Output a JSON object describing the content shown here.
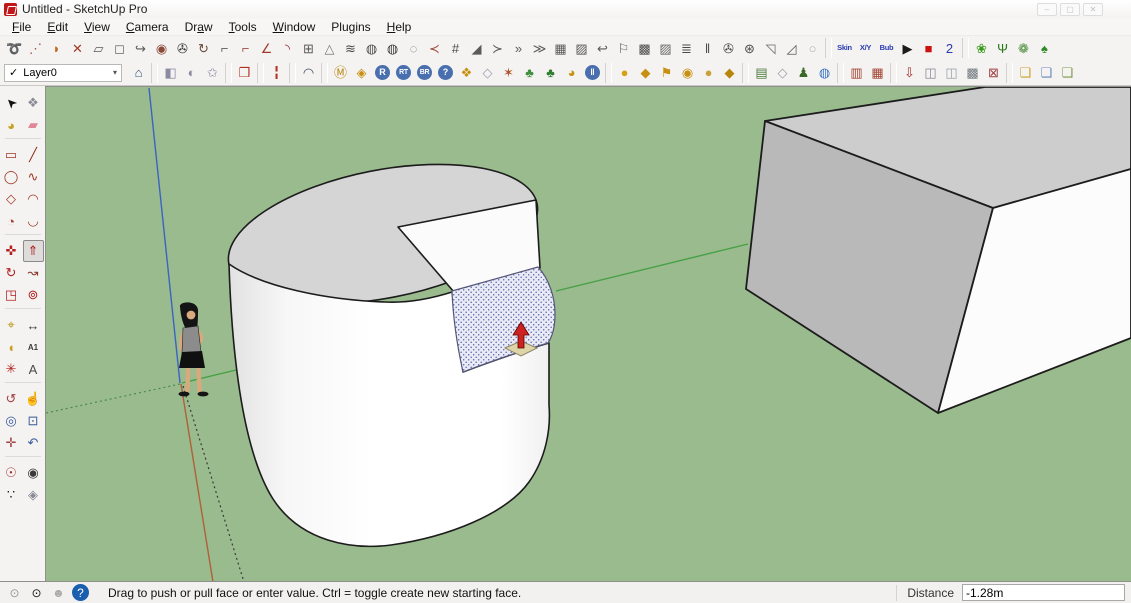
{
  "window": {
    "title": "Untitled - SketchUp Pro",
    "buttons": [
      {
        "name": "minimize-button",
        "glyph": "–"
      },
      {
        "name": "maximize-button",
        "glyph": "▢"
      },
      {
        "name": "close-button",
        "glyph": "✕"
      }
    ]
  },
  "menu": {
    "items": [
      {
        "name": "menu-file",
        "pre": "",
        "u": "F",
        "post": "ile"
      },
      {
        "name": "menu-edit",
        "pre": "",
        "u": "E",
        "post": "dit"
      },
      {
        "name": "menu-view",
        "pre": "",
        "u": "V",
        "post": "iew"
      },
      {
        "name": "menu-camera",
        "pre": "",
        "u": "C",
        "post": "amera"
      },
      {
        "name": "menu-draw",
        "pre": "Dr",
        "u": "a",
        "post": "w"
      },
      {
        "name": "menu-tools",
        "pre": "",
        "u": "T",
        "post": "ools"
      },
      {
        "name": "menu-window",
        "pre": "",
        "u": "W",
        "post": "indow"
      },
      {
        "name": "menu-plugins",
        "pre": "Plugins",
        "u": "",
        "post": ""
      },
      {
        "name": "menu-help",
        "pre": "",
        "u": "H",
        "post": "elp"
      }
    ]
  },
  "toolbar1": {
    "icons": [
      {
        "name": "loop-tool-icon",
        "glyph": "➰",
        "color": "#5a5a5a"
      },
      {
        "name": "dotted-arc-tool-icon",
        "glyph": "⋰",
        "color": "#a05040"
      },
      {
        "name": "orange-sweep-tool-icon",
        "glyph": "◗",
        "color": "#c06a20"
      },
      {
        "name": "red-cut-tool-icon",
        "glyph": "✕",
        "color": "#a03a2a"
      },
      {
        "name": "outline-polygon-tool-icon",
        "glyph": "▱",
        "color": "#5a5a5a"
      },
      {
        "name": "outline-shape-tool-icon",
        "glyph": "◻",
        "color": "#6a6a6a"
      },
      {
        "name": "curl-tool-icon",
        "glyph": "↪",
        "color": "#5a5a5a"
      },
      {
        "name": "red-dot-shape-tool-icon",
        "glyph": "◉",
        "color": "#8a4a3a"
      },
      {
        "name": "knot-tool-icon",
        "glyph": "✇",
        "color": "#3a3a3a"
      },
      {
        "name": "curl-arrow-tool-icon",
        "glyph": "↻",
        "color": "#6a4a3a"
      },
      {
        "name": "corner-lines-tool-icon",
        "glyph": "⌐",
        "color": "#5a5a5a"
      },
      {
        "name": "corner-red-tool-icon",
        "glyph": "⌐",
        "color": "#a04a3a"
      },
      {
        "name": "angle-arrow-tool-icon",
        "glyph": "∠",
        "color": "#a03a2a"
      },
      {
        "name": "red-curve-tool-icon",
        "glyph": "◝",
        "color": "#8a2a2a"
      },
      {
        "name": "grid-box-tool-icon",
        "glyph": "⊞",
        "color": "#5a5a5a"
      },
      {
        "name": "cone-tool-icon",
        "glyph": "△",
        "color": "#7a7a7a"
      },
      {
        "name": "wave-texture-tool-icon",
        "glyph": "≋",
        "color": "#4a4a4a"
      },
      {
        "name": "dark-sphere-tool-icon",
        "glyph": "◍",
        "color": "#4a4a4a"
      },
      {
        "name": "dark-sphere-2-tool-icon",
        "glyph": "◍",
        "color": "#3a3a3a"
      },
      {
        "name": "outline-curl-tool-icon",
        "glyph": "◌",
        "color": "#6a6a6a"
      },
      {
        "name": "red-bracket-tool-icon",
        "glyph": "≺",
        "color": "#a04a3a"
      },
      {
        "name": "fence-tool-icon",
        "glyph": "#",
        "color": "#4a4a4a"
      },
      {
        "name": "wedge-tool-icon",
        "glyph": "◢",
        "color": "#5a5a5a"
      },
      {
        "name": "arrow-tool-icon",
        "glyph": "≻",
        "color": "#5a5a5a"
      },
      {
        "name": "double-arrow-tool-icon",
        "glyph": "»",
        "color": "#5a5a5a"
      },
      {
        "name": "triple-arrow-tool-icon",
        "glyph": "≫",
        "color": "#5a5a5a"
      },
      {
        "name": "textured-square-tool-icon",
        "glyph": "▦",
        "color": "#5a5a5a"
      },
      {
        "name": "stripes-tool-icon",
        "glyph": "▨",
        "color": "#5a5a5a"
      },
      {
        "name": "small-curl-tool-icon",
        "glyph": "↩",
        "color": "#5a5a5a"
      },
      {
        "name": "flag-tool-icon",
        "glyph": "⚐",
        "color": "#5a5a5a"
      },
      {
        "name": "grid-dark-tool-icon",
        "glyph": "▩",
        "color": "#4a4a4a"
      },
      {
        "name": "hatch-square-tool-icon",
        "glyph": "▨",
        "color": "#6a6a6a"
      },
      {
        "name": "stacked-lines-tool-icon",
        "glyph": "≣",
        "color": "#4a4a4a"
      },
      {
        "name": "vertical-bars-tool-icon",
        "glyph": "‖",
        "color": "#4a4a4a"
      },
      {
        "name": "knot-2-tool-icon",
        "glyph": "✇",
        "color": "#4a4a4a"
      },
      {
        "name": "spoke-arrows-tool-icon",
        "glyph": "⊛",
        "color": "#4a4a4a"
      },
      {
        "name": "fan-tool-icon",
        "glyph": "◹",
        "color": "#6a6a6a"
      },
      {
        "name": "striped-fan-tool-icon",
        "glyph": "◿",
        "color": "#5a5a5a"
      },
      {
        "name": "pale-octagon-tool-icon",
        "glyph": "○",
        "color": "#b0b0b0"
      },
      {
        "sep": true
      },
      {
        "name": "skin-tool-icon",
        "glyph": "Skin",
        "color": "#2a3ab0",
        "small": true
      },
      {
        "name": "xy-tool-icon",
        "glyph": "X/Y",
        "color": "#2a3ab0",
        "small": true
      },
      {
        "name": "bubble-tool-icon",
        "glyph": "Bub",
        "color": "#2a3ab0",
        "small": true
      },
      {
        "name": "play-button-icon",
        "glyph": "▶",
        "color": "#1a1a1a"
      },
      {
        "name": "stop-button-icon",
        "glyph": "■",
        "color": "#cc1111"
      },
      {
        "name": "s2-tool-icon",
        "glyph": "2",
        "color": "#2a3ab0"
      },
      {
        "sep": true
      },
      {
        "name": "plant-turnip-icon",
        "glyph": "❀",
        "color": "#3a9a1a"
      },
      {
        "name": "plant-grass-icon",
        "glyph": "Ψ",
        "color": "#2a7a1a"
      },
      {
        "name": "plant-swirl-icon",
        "glyph": "❁",
        "color": "#4a8a3a"
      },
      {
        "name": "plant-bush-icon",
        "glyph": "♠",
        "color": "#2a8a2a"
      }
    ]
  },
  "toolbar2": {
    "check": "✓",
    "layer": "Layer0",
    "arrow": "▾",
    "icons": [
      {
        "name": "house-info-icon",
        "glyph": "⌂",
        "color": "#33557a"
      },
      {
        "sep": true
      },
      {
        "name": "face-camera-1-icon",
        "glyph": "◧",
        "color": "#8a8aa0"
      },
      {
        "name": "face-camera-2-icon",
        "glyph": "◐",
        "color": "#8a8aa0"
      },
      {
        "name": "face-camera-3-icon",
        "glyph": "✩",
        "color": "#8a8aa0"
      },
      {
        "sep": true
      },
      {
        "name": "red-door-icon",
        "glyph": "❒",
        "color": "#b03020"
      },
      {
        "sep": true
      },
      {
        "name": "red-posts-icon",
        "glyph": "╏",
        "color": "#b03020"
      },
      {
        "sep": true
      },
      {
        "name": "arc-dome-icon",
        "glyph": "◠",
        "color": "#44506a"
      },
      {
        "sep": true
      },
      {
        "name": "gold-m-icon",
        "glyph": "Ⓜ",
        "color": "#b8860b"
      },
      {
        "name": "gold-gem-icon",
        "glyph": "◈",
        "color": "#c89010"
      },
      {
        "name": "blue-r-icon",
        "glyph": "R",
        "color": "#ffffff",
        "bg": "#4a6fae",
        "round": true
      },
      {
        "name": "blue-rt-icon",
        "glyph": "RT",
        "color": "#ffffff",
        "bg": "#4a6fae",
        "round": true,
        "small": true
      },
      {
        "name": "blue-br-icon",
        "glyph": "BR",
        "color": "#ffffff",
        "bg": "#4a6fae",
        "round": true,
        "small": true
      },
      {
        "name": "blue-question-icon",
        "glyph": "?",
        "color": "#ffffff",
        "bg": "#4a6fae",
        "round": true
      },
      {
        "name": "gold-tag-icon",
        "glyph": "❖",
        "color": "#c89010"
      },
      {
        "name": "white-gem-icon",
        "glyph": "◇",
        "color": "#9aa0b0"
      },
      {
        "name": "spark-icon",
        "glyph": "✶",
        "color": "#b05530"
      },
      {
        "name": "tree-1-icon",
        "glyph": "♣",
        "color": "#3e8e3e"
      },
      {
        "name": "tree-2-icon",
        "glyph": "♣",
        "color": "#2e7e2e"
      },
      {
        "name": "gold-clock-icon",
        "glyph": "◕",
        "color": "#c89010"
      },
      {
        "name": "pause-icon",
        "glyph": "‖",
        "color": "#ffffff",
        "bg": "#4a6fae",
        "round": true
      },
      {
        "sep": true
      },
      {
        "name": "gold-sphere-icon",
        "glyph": "●",
        "color": "#d4a017"
      },
      {
        "name": "gold-saucer-icon",
        "glyph": "◆",
        "color": "#c89010"
      },
      {
        "name": "gold-flag-icon",
        "glyph": "⚑",
        "color": "#c89010"
      },
      {
        "name": "gold-coin-icon",
        "glyph": "◉",
        "color": "#c89010"
      },
      {
        "name": "gold-sphere-2-icon",
        "glyph": "●",
        "color": "#caa23a"
      },
      {
        "name": "gold-top-icon",
        "glyph": "◆",
        "color": "#b8860b"
      },
      {
        "sep": true
      },
      {
        "name": "landscape-icon",
        "glyph": "▤",
        "color": "#4a7a3a"
      },
      {
        "name": "gem-icon",
        "glyph": "◇",
        "color": "#99a0aa"
      },
      {
        "name": "person-plant-icon",
        "glyph": "♟",
        "color": "#3a6a2a"
      },
      {
        "name": "google-earth-icon",
        "glyph": "◍",
        "color": "#3a72c4"
      },
      {
        "sep": true
      },
      {
        "name": "red-texture-box-icon",
        "glyph": "▥",
        "color": "#a04030"
      },
      {
        "name": "red-grid-box-icon",
        "glyph": "▦",
        "color": "#a04030"
      },
      {
        "sep": true
      },
      {
        "name": "box-red-arrow-icon",
        "glyph": "⇩",
        "color": "#a03030"
      },
      {
        "name": "box-gray-1-icon",
        "glyph": "◫",
        "color": "#888898"
      },
      {
        "name": "box-gray-2-icon",
        "glyph": "◫",
        "color": "#98a0a8"
      },
      {
        "name": "box-dark-icon",
        "glyph": "▩",
        "color": "#707880"
      },
      {
        "name": "box-red-x-icon",
        "glyph": "⊠",
        "color": "#a04040"
      },
      {
        "sep": true
      },
      {
        "name": "cube-yellow-icon",
        "glyph": "❏",
        "color": "#c9a227"
      },
      {
        "name": "cube-blue-icon",
        "glyph": "❏",
        "color": "#6688bb"
      },
      {
        "name": "cube-green-icon",
        "glyph": "❏",
        "color": "#7a9a4a"
      }
    ]
  },
  "left_toolbar": {
    "icons": [
      {
        "name": "select-tool-icon",
        "glyph": "➤",
        "color": "#111111",
        "cls": "r135"
      },
      {
        "name": "make-component-icon",
        "glyph": "❖",
        "color": "#8a8a96"
      },
      {
        "name": "paint-bucket-icon",
        "glyph": "◕",
        "color": "#c8a020"
      },
      {
        "name": "eraser-icon",
        "glyph": "▰",
        "color": "#e08898"
      },
      {
        "sep": true
      },
      {
        "name": "rectangle-tool-icon",
        "glyph": "▭",
        "color": "#a03a2a"
      },
      {
        "name": "line-tool-icon",
        "glyph": "╱",
        "color": "#8a2a1a"
      },
      {
        "name": "circle-tool-icon",
        "glyph": "◯",
        "color": "#a03a2a"
      },
      {
        "name": "freehand-tool-icon",
        "glyph": "∿",
        "color": "#a03a2a"
      },
      {
        "name": "polygon-tool-icon",
        "glyph": "◇",
        "color": "#a03a2a"
      },
      {
        "name": "arc-tool-icon",
        "glyph": "◠",
        "color": "#a03a2a"
      },
      {
        "name": "pie-tool-icon",
        "glyph": "◔",
        "color": "#a03a2a"
      },
      {
        "name": "arc-2-tool-icon",
        "glyph": "◡",
        "color": "#a03a2a"
      },
      {
        "sep": true
      },
      {
        "name": "move-tool-icon",
        "glyph": "✜",
        "color": "#b02020"
      },
      {
        "name": "push-pull-tool-icon",
        "glyph": "⇑",
        "color": "#b02020",
        "selected": true
      },
      {
        "name": "rotate-tool-icon",
        "glyph": "↻",
        "color": "#b02020"
      },
      {
        "name": "follow-me-tool-icon",
        "glyph": "↝",
        "color": "#8a3a2a"
      },
      {
        "name": "scale-tool-icon",
        "glyph": "◳",
        "color": "#b02020"
      },
      {
        "name": "offset-tool-icon",
        "glyph": "⊚",
        "color": "#b02020"
      },
      {
        "sep": true
      },
      {
        "name": "tape-measure-icon",
        "glyph": "⌖",
        "color": "#b8930a"
      },
      {
        "name": "dimension-tool-icon",
        "glyph": "↔",
        "color": "#3a3a3a"
      },
      {
        "name": "protractor-icon",
        "glyph": "◖",
        "color": "#c8a020"
      },
      {
        "name": "text-tool-icon",
        "glyph": "A1",
        "color": "#3a3a3a",
        "small": true
      },
      {
        "name": "axes-tool-icon",
        "glyph": "✳",
        "color": "#b02020"
      },
      {
        "name": "three-d-text-icon",
        "glyph": "A",
        "color": "#4a4a4a"
      },
      {
        "sep": true
      },
      {
        "name": "orbit-tool-icon",
        "glyph": "↺",
        "color": "#a04040"
      },
      {
        "name": "pan-tool-icon",
        "glyph": "☝",
        "color": "#4a4a4a"
      },
      {
        "name": "zoom-tool-icon",
        "glyph": "◎",
        "color": "#3a5a9a"
      },
      {
        "name": "zoom-window-icon",
        "glyph": "⊡",
        "color": "#3a5a9a"
      },
      {
        "name": "zoom-extents-icon",
        "glyph": "✛",
        "color": "#a04040"
      },
      {
        "name": "previous-view-icon",
        "glyph": "↶",
        "color": "#3a5a9a"
      },
      {
        "sep": true
      },
      {
        "name": "position-camera-icon",
        "glyph": "☉",
        "color": "#a03030"
      },
      {
        "name": "look-around-icon",
        "glyph": "◉",
        "color": "#3a3a3a"
      },
      {
        "name": "walk-tool-icon",
        "glyph": "∵",
        "color": "#1a1a1a"
      },
      {
        "name": "section-plane-icon",
        "glyph": "◈",
        "color": "#8a8a96"
      }
    ]
  },
  "statusbar": {
    "icons": [
      {
        "name": "geolocation-icon",
        "glyph": "⊙",
        "color": "#999999"
      },
      {
        "name": "claim-model-icon",
        "glyph": "⊙",
        "color": "#1a1a1a"
      },
      {
        "name": "sign-in-icon",
        "glyph": "☻",
        "color": "#aaaaaa"
      },
      {
        "name": "help-icon",
        "glyph": "?",
        "color": "#ffffff",
        "bg": "#1a5fae",
        "round": true
      }
    ],
    "message": "Drag to push or pull face or enter value.  Ctrl = toggle create new starting face.",
    "distance_label": "Distance",
    "distance_value": "-1.28m"
  },
  "scene": {
    "background": "#9abb8d",
    "selection_fill": "#e9eaf5",
    "selection_dot": "#5566aa",
    "axis_red": "#b0603a",
    "axis_green": "#46a046",
    "axis_blue": "#3b63c4",
    "cylinder_top": "#d5d5d5",
    "box_top": "#cdcdcd",
    "box_left": "#b9b9b9",
    "box_front": "#fcfcfc"
  }
}
